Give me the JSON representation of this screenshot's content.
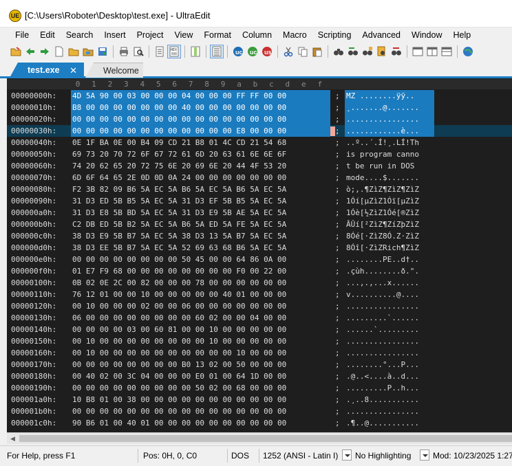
{
  "window": {
    "title": "[C:\\Users\\Roboter\\Desktop\\test.exe] - UltraEdit",
    "logo_text": "UE"
  },
  "menu": [
    "File",
    "Edit",
    "Search",
    "Insert",
    "Project",
    "View",
    "Format",
    "Column",
    "Macro",
    "Scripting",
    "Advanced",
    "Window",
    "Help"
  ],
  "toolbar": {
    "icons": [
      "open-folder-icon",
      "back-arrow-icon",
      "forward-arrow-icon",
      "new-file-icon",
      "open-file-icon",
      "open-file-2-icon",
      "save-icon",
      "separator",
      "print-icon",
      "print-preview-icon",
      "separator",
      "document-icon",
      "hex-mode-icon",
      "separator",
      "column-mode-icon",
      "separator",
      "list-icon",
      "separator",
      "compare-icon",
      "script-icon",
      "macro-icon",
      "separator",
      "cut-icon",
      "copy-icon",
      "paste-icon",
      "separator",
      "binoculars-icon",
      "find-replace-icon",
      "find-in-files-icon",
      "replace-in-files-icon",
      "replace-icon",
      "separator",
      "window-1-icon",
      "window-2-icon",
      "window-3-icon",
      "separator",
      "globe-icon"
    ]
  },
  "tabs": [
    {
      "label": "test.exe",
      "active": true,
      "close": "✕"
    },
    {
      "label": "Welcome",
      "active": false
    }
  ],
  "hex_editor": {
    "ruler": [
      "0",
      "1",
      "2",
      "3",
      "4",
      "5",
      "6",
      "7",
      "8",
      "9",
      "a",
      "b",
      "c",
      "d",
      "e",
      "f"
    ],
    "separator": ";",
    "rows": [
      {
        "offset": "00000000h:",
        "hex": "4D 5A 90 00 03 00 00 00 04 00 00 00 FF FF 00 00",
        "ascii": "MZ ........ÿÿ.."
      },
      {
        "offset": "00000010h:",
        "hex": "B8 00 00 00 00 00 00 00 40 00 00 00 00 00 00 00",
        "ascii": "¸.......@......."
      },
      {
        "offset": "00000020h:",
        "hex": "00 00 00 00 00 00 00 00 00 00 00 00 00 00 00 00",
        "ascii": "................"
      },
      {
        "offset": "00000030h:",
        "hex": "00 00 00 00 00 00 00 00 00 00 00 00 E8 00 00 00",
        "ascii": "............è..."
      },
      {
        "offset": "00000040h:",
        "hex": "0E 1F BA 0E 00 B4 09 CD 21 B8 01 4C CD 21 54 68",
        "ascii": "..º..´.Í!¸.LÍ!Th"
      },
      {
        "offset": "00000050h:",
        "hex": "69 73 20 70 72 6F 67 72 61 6D 20 63 61 6E 6E 6F",
        "ascii": "is program canno"
      },
      {
        "offset": "00000060h:",
        "hex": "74 20 62 65 20 72 75 6E 20 69 6E 20 44 4F 53 20",
        "ascii": "t be run in DOS "
      },
      {
        "offset": "00000070h:",
        "hex": "6D 6F 64 65 2E 0D 0D 0A 24 00 00 00 00 00 00 00",
        "ascii": "mode....$......."
      },
      {
        "offset": "00000080h:",
        "hex": "F2 3B 82 09 B6 5A EC 5A B6 5A EC 5A B6 5A EC 5A",
        "ascii": "ò;‚.¶ZìZ¶ZìZ¶ZìZ"
      },
      {
        "offset": "00000090h:",
        "hex": "31 D3 ED 5B B5 5A EC 5A 31 D3 EF 5B B5 5A EC 5A",
        "ascii": "1Óí[µZìZ1Óï[µZìZ"
      },
      {
        "offset": "000000a0h:",
        "hex": "31 D3 E8 5B BD 5A EC 5A 31 D3 E9 5B AE 5A EC 5A",
        "ascii": "1Óè[½ZìZ1Óé[®ZìZ"
      },
      {
        "offset": "000000b0h:",
        "hex": "C2 DB ED 5B B2 5A EC 5A B6 5A ED 5A FE 5A EC 5A",
        "ascii": "ÂÛí[²ZìZ¶ZíZþZìZ"
      },
      {
        "offset": "000000c0h:",
        "hex": "38 D3 E9 5B B7 5A EC 5A 38 D3 13 5A B7 5A EC 5A",
        "ascii": "8Óé[·ZìZ8Ó.Z·ZìZ"
      },
      {
        "offset": "000000d0h:",
        "hex": "38 D3 EE 5B B7 5A EC 5A 52 69 63 68 B6 5A EC 5A",
        "ascii": "8Óî[·ZìZRich¶ZìZ"
      },
      {
        "offset": "000000e0h:",
        "hex": "00 00 00 00 00 00 00 00 50 45 00 00 64 86 0A 00",
        "ascii": "........PE..d†.."
      },
      {
        "offset": "000000f0h:",
        "hex": "01 E7 F9 68 00 00 00 00 00 00 00 00 F0 00 22 00",
        "ascii": ".çùh........ð.\"."
      },
      {
        "offset": "00000100h:",
        "hex": "0B 02 0E 2C 00 82 00 00 00 78 00 00 00 00 00 00",
        "ascii": "...,.‚...x......"
      },
      {
        "offset": "00000110h:",
        "hex": "76 12 01 00 00 10 00 00 00 00 00 40 01 00 00 00",
        "ascii": "v..........@...."
      },
      {
        "offset": "00000120h:",
        "hex": "00 10 00 00 00 02 00 00 06 00 00 00 00 00 00 00",
        "ascii": "................"
      },
      {
        "offset": "00000130h:",
        "hex": "06 00 00 00 00 00 00 00 00 60 02 00 00 04 00 00",
        "ascii": ".........`......"
      },
      {
        "offset": "00000140h:",
        "hex": "00 00 00 00 03 00 60 81 00 00 10 00 00 00 00 00",
        "ascii": "......`........."
      },
      {
        "offset": "00000150h:",
        "hex": "00 10 00 00 00 00 00 00 00 00 10 00 00 00 00 00",
        "ascii": "................"
      },
      {
        "offset": "00000160h:",
        "hex": "00 10 00 00 00 00 00 00 00 00 00 00 10 00 00 00",
        "ascii": "................"
      },
      {
        "offset": "00000170h:",
        "hex": "00 00 00 00 00 00 00 00 B0 13 02 00 50 00 00 00",
        "ascii": "........°...P..."
      },
      {
        "offset": "00000180h:",
        "hex": "00 40 02 00 3C 04 00 00 00 E0 01 00 64 1D 00 00",
        "ascii": ".@..<....à..d..."
      },
      {
        "offset": "00000190h:",
        "hex": "00 00 00 00 00 00 00 00 00 50 02 00 68 00 00 00",
        "ascii": ".........P..h..."
      },
      {
        "offset": "000001a0h:",
        "hex": "10 B8 01 00 38 00 00 00 00 00 00 00 00 00 00 00",
        "ascii": ".¸..8..........."
      },
      {
        "offset": "000001b0h:",
        "hex": "00 00 00 00 00 00 00 00 00 00 00 00 00 00 00 00",
        "ascii": "................"
      },
      {
        "offset": "000001c0h:",
        "hex": "90 B6 01 00 40 01 00 00 00 00 00 00 00 00 00 00",
        "ascii": ".¶..@..........."
      }
    ],
    "selected_rows": [
      0,
      1,
      2,
      3
    ],
    "current_row": 3
  },
  "statusbar": {
    "help": "For Help, press F1",
    "position": "Pos: 0H, 0, C0",
    "line_ending": "DOS",
    "codepage": "1252  (ANSI - Latin I)",
    "highlighting": "No Highlighting",
    "modified": "Mod: 10/23/2025 1:27:"
  },
  "colors": {
    "accent": "#1d7ec4",
    "editor_bg": "#1e1e1e",
    "selection": "#1b7bbf",
    "current_line": "#0e3c52",
    "cursor": "#f2a79a"
  }
}
